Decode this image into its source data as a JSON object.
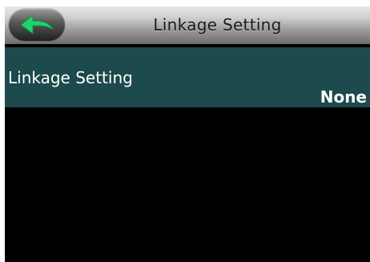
{
  "header": {
    "title": "Linkage Setting",
    "back_icon": "back-arrow-icon",
    "back_icon_color": "#1fd36b"
  },
  "items": [
    {
      "label": "Linkage Setting",
      "value": "None"
    }
  ],
  "colors": {
    "row_background": "#1d4a4c",
    "screen_background": "#000000"
  }
}
